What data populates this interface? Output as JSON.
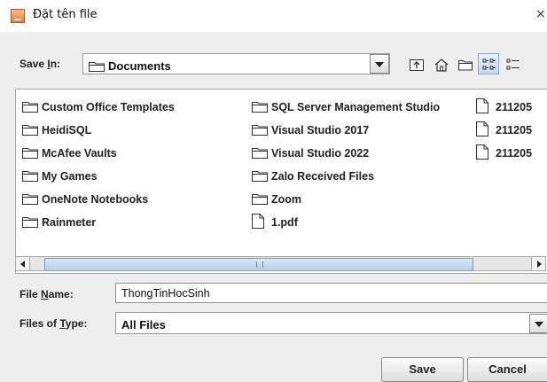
{
  "window": {
    "title": "Đặt tên file",
    "close_glyph": "×"
  },
  "save_in": {
    "label_pre": "Save ",
    "label_key": "I",
    "label_post": "n:",
    "value": "Documents"
  },
  "toolbar_icons": [
    "up-one-level-icon",
    "home-icon",
    "new-folder-icon",
    "list-view-icon",
    "details-view-icon"
  ],
  "files": {
    "col1": [
      "Custom Office Templates",
      "HeidiSQL",
      "McAfee Vaults",
      "My Games",
      "OneNote Notebooks",
      "Rainmeter"
    ],
    "col2_folders": [
      "SQL Server Management Studio",
      "Visual Studio 2017",
      "Visual Studio 2022",
      "Zalo Received Files",
      "Zoom"
    ],
    "col2_file": "1.pdf",
    "col3": [
      "211205",
      "211205",
      "211205"
    ]
  },
  "file_name": {
    "label_pre": "File ",
    "label_key": "N",
    "label_post": "ame:",
    "value": "ThongTinHocSinh"
  },
  "file_type": {
    "label_pre": "Files of ",
    "label_key": "T",
    "label_post": "ype:",
    "value": "All Files"
  },
  "buttons": {
    "save": "Save",
    "cancel": "Cancel"
  }
}
